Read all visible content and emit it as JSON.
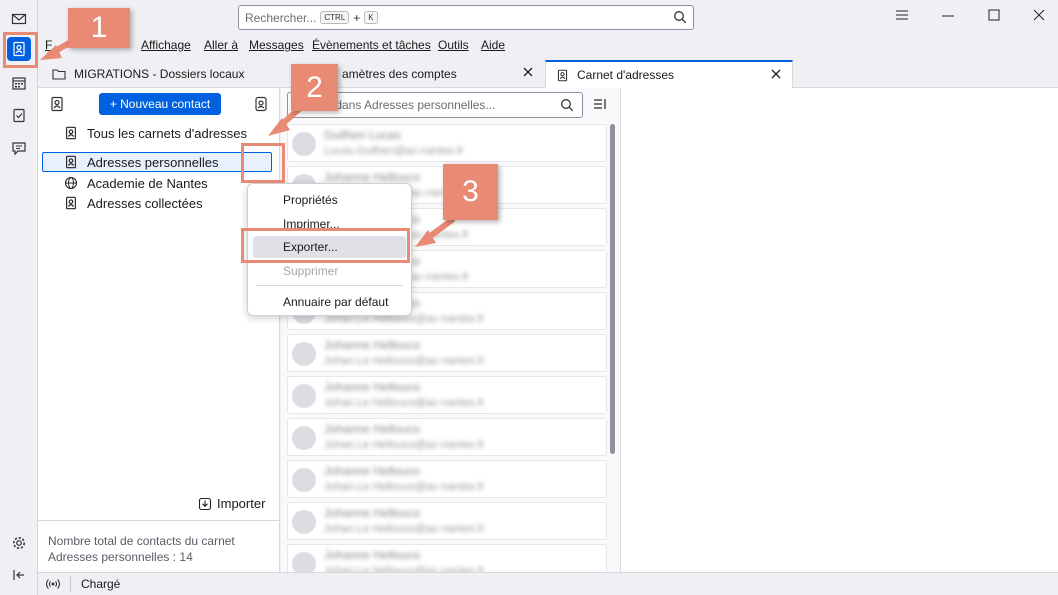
{
  "search": {
    "placeholder": "Rechercher...",
    "shortcut_ctrl": "CTRL",
    "shortcut_plus": "+",
    "shortcut_key": "K"
  },
  "menu": {
    "file_partial": "F",
    "items": [
      "Affichage",
      "Aller à",
      "Messages",
      "Évènements et tâches",
      "Outils",
      "Aide"
    ]
  },
  "tabs": [
    {
      "label": "MIGRATIONS - Dossiers locaux"
    },
    {
      "label": "amètres des comptes"
    },
    {
      "label": "Carnet d'adresses"
    }
  ],
  "address_books": {
    "new_contact": "+ Nouveau contact",
    "items": [
      "Tous les carnets d'adresses",
      "Adresses personnelles",
      "Academie de Nantes",
      "Adresses collectées"
    ],
    "import_label": "Importer",
    "count_line1": "Nombre total de contacts du carnet",
    "count_line2": "Adresses personnelles : 14"
  },
  "contacts": {
    "search_placeholder": "r dans Adresses personnelles...",
    "cards": [
      {
        "name": "Guilhen Lucas",
        "email": "Lucas.Guilhen@ac-nantes.fr"
      },
      {
        "name": "Johanne Hellouco",
        "email": "Johan.Hellouco@ac-nantes.fr"
      },
      {
        "name": "Johanne Hellouco",
        "email": "Johan.Hellouco@ac-nantes.fr"
      },
      {
        "name": "Johanne Hellouco",
        "email": "Johan.Hellouco@ac-nantes.fr"
      },
      {
        "name": "Johanne Hellouco",
        "email": "Johan.Le Hellouco@ac-nantes.fr"
      },
      {
        "name": "Johanne Hellouco",
        "email": "Johan.Le Hellouco@ac-nantes.fr"
      },
      {
        "name": "Johanne Hellouco",
        "email": "Johan.Le Hellouco@ac-nantes.fr"
      },
      {
        "name": "Johanne Hellouco",
        "email": "Johan.Le Hellouco@ac-nantes.fr"
      },
      {
        "name": "Johanne Hellouco",
        "email": "Johan.Le Hellouco@ac-nantes.fr"
      },
      {
        "name": "Johanne Hellouco",
        "email": "Johan.Le Hellouco@ac-nantes.fr"
      },
      {
        "name": "Johanne Hellouco",
        "email": "Johan.Le Hellouco@ac-nantes.fr"
      }
    ]
  },
  "context_menu": {
    "items": [
      "Propriétés",
      "Imprimer...",
      "Exporter...",
      "Supprimer",
      "Annuaire par défaut"
    ]
  },
  "status": {
    "text": "Chargé"
  },
  "callouts": [
    "1",
    "2",
    "3"
  ],
  "colors": {
    "accent": "#0061e0",
    "callout": "#e88a74"
  }
}
